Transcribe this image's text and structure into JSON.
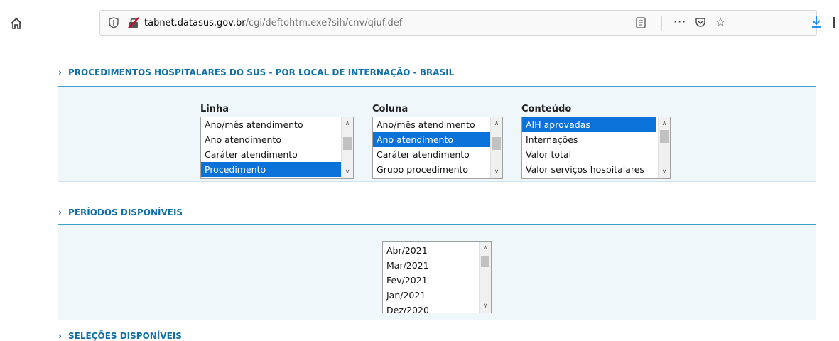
{
  "browser": {
    "url_host": "tabnet.datasus.gov.br",
    "url_path": "/cgi/deftohtm.exe?sih/cnv/qiuf.def",
    "more_label": "···"
  },
  "sections": {
    "main_title": "PROCEDIMENTOS HOSPITALARES DO SUS - POR LOCAL DE INTERNAÇÃO - BRASIL",
    "periods_title": "PERÍODOS DISPONÍVEIS",
    "selections_title": "SELEÇÕES DISPONÍVEIS"
  },
  "linha": {
    "label": "Linha",
    "options": [
      "Ano/mês atendimento",
      "Ano atendimento",
      "Caráter atendimento",
      "Procedimento"
    ],
    "selected": "Procedimento"
  },
  "coluna": {
    "label": "Coluna",
    "options": [
      "Ano/mês atendimento",
      "Ano atendimento",
      "Caráter atendimento",
      "Grupo procedimento"
    ],
    "selected": "Ano atendimento"
  },
  "conteudo": {
    "label": "Conteúdo",
    "options": [
      "AIH aprovadas",
      "Internações",
      "Valor total",
      "Valor serviços hospitalares"
    ],
    "selected": "AIH aprovadas"
  },
  "periodos": {
    "options": [
      "Abr/2021",
      "Mar/2021",
      "Fev/2021",
      "Jan/2021",
      "Dez/2020"
    ]
  },
  "colors": {
    "accent": "#0f70a8",
    "selection": "#0a72d8",
    "panel_bg": "#f0f7fb"
  }
}
